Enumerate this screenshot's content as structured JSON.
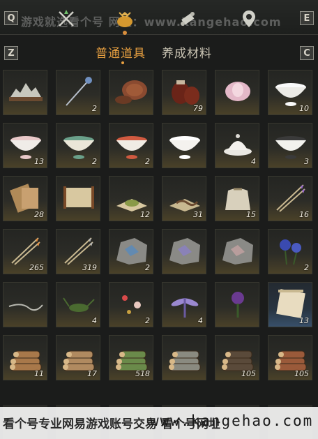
{
  "header": {
    "key_left": "Q",
    "key_right": "E",
    "icons": [
      "crossed-swords-icon",
      "money-bag-icon",
      "scroll-icon",
      "map-pin-icon"
    ],
    "watermark": "游戏就选看个号 网址：www.kangehao.com"
  },
  "tabs": {
    "key_left": "Z",
    "key_right": "C",
    "items": [
      {
        "label": "普通道具",
        "active": true
      },
      {
        "label": "养成材料",
        "active": false
      }
    ]
  },
  "items": [
    {
      "icon": "landscape-rock-icon",
      "count": ""
    },
    {
      "icon": "ornate-hairpin-icon",
      "count": "2"
    },
    {
      "icon": "lacquer-box-icon",
      "count": ""
    },
    {
      "icon": "wine-jars-icon",
      "count": "79"
    },
    {
      "icon": "lotus-flower-icon",
      "count": ""
    },
    {
      "icon": "porcelain-bowl-icon",
      "count": "10"
    },
    {
      "icon": "floral-bowl-icon",
      "count": "13"
    },
    {
      "icon": "painted-bowl-icon",
      "count": "2"
    },
    {
      "icon": "rooster-bowl-icon",
      "count": "2"
    },
    {
      "icon": "white-bowl-icon",
      "count": ""
    },
    {
      "icon": "lidded-cup-icon",
      "count": "4"
    },
    {
      "icon": "rimmed-bowl-icon",
      "count": "3"
    },
    {
      "icon": "bamboo-slips-icon",
      "count": "28"
    },
    {
      "icon": "painting-scroll-icon",
      "count": ""
    },
    {
      "icon": "herb-powder-icon",
      "count": "12"
    },
    {
      "icon": "worm-cloth-icon",
      "count": "31"
    },
    {
      "icon": "cloth-sack-icon",
      "count": "15"
    },
    {
      "icon": "purple-arrows-icon",
      "count": "16"
    },
    {
      "icon": "fire-arrows-icon",
      "count": "265"
    },
    {
      "icon": "iron-arrows-icon",
      "count": "319"
    },
    {
      "icon": "blue-ore-icon",
      "count": "2"
    },
    {
      "icon": "violet-ore-icon",
      "count": ""
    },
    {
      "icon": "pink-ore-icon",
      "count": ""
    },
    {
      "icon": "blue-flowers-icon",
      "count": "2"
    },
    {
      "icon": "branch-twig-icon",
      "count": ""
    },
    {
      "icon": "cricket-icon",
      "count": "4"
    },
    {
      "icon": "butterflies-icon",
      "count": "2"
    },
    {
      "icon": "dragonfly-icon",
      "count": "4"
    },
    {
      "icon": "purple-herb-icon",
      "count": ""
    },
    {
      "icon": "paper-scroll-icon",
      "count": "13",
      "rarity": "blue"
    },
    {
      "icon": "pine-logs-icon",
      "count": "11"
    },
    {
      "icon": "cedar-logs-icon",
      "count": "17"
    },
    {
      "icon": "bamboo-logs-icon",
      "count": "518"
    },
    {
      "icon": "grey-logs-icon",
      "count": ""
    },
    {
      "icon": "dark-logs-icon",
      "count": "105"
    },
    {
      "icon": "red-logs-icon",
      "count": "105"
    }
  ],
  "footer_watermark": {
    "text": "看个号专业网易游戏账号交易 看个号网址",
    "url": "www.kangehao.com"
  },
  "colors": {
    "active_tab": "#e8a040",
    "panel_bg": "#1b1c1b"
  }
}
